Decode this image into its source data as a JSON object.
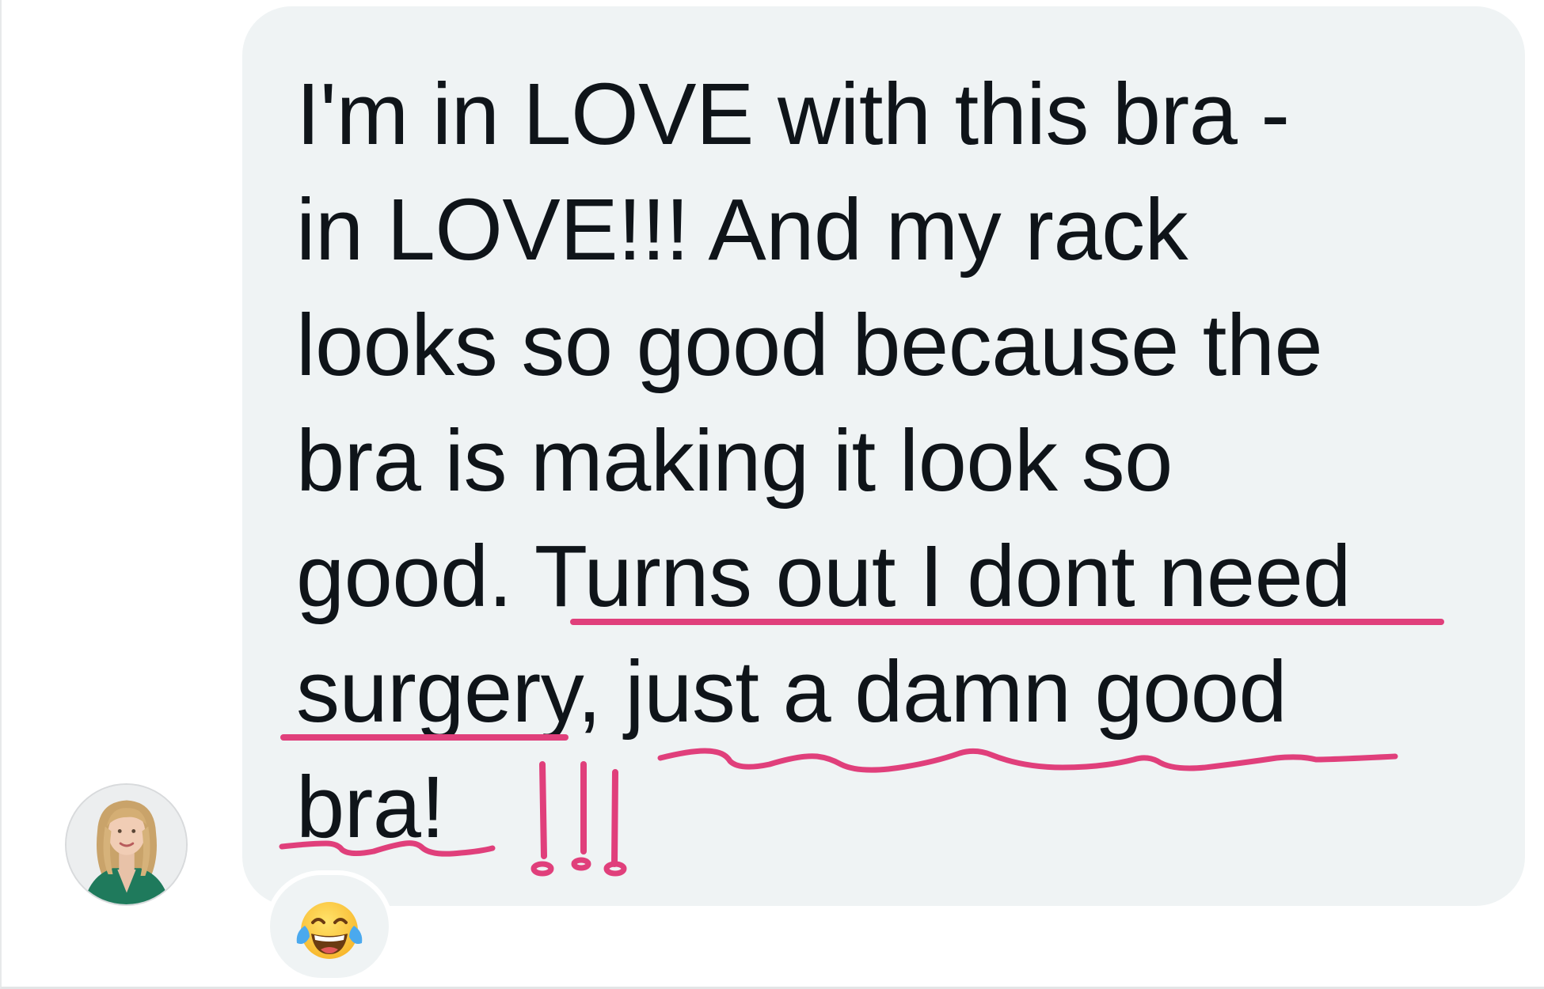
{
  "message": {
    "lines": [
      "I'm in LOVE with this bra -",
      "in LOVE!!! And my rack",
      "looks so good because the",
      "bra is making it look so",
      "good. Turns out I dont need",
      "surgery, just a damn good",
      "bra!"
    ]
  },
  "avatar": {
    "icon": "user-avatar-photo"
  },
  "reaction": {
    "icon": "face-with-tears-of-joy-icon"
  },
  "annotation": {
    "color": "#e03f7b",
    "marks": "!!!"
  },
  "colors": {
    "bubble": "#eff3f4",
    "text": "#0f1419",
    "highlight": "#e03f7b"
  }
}
